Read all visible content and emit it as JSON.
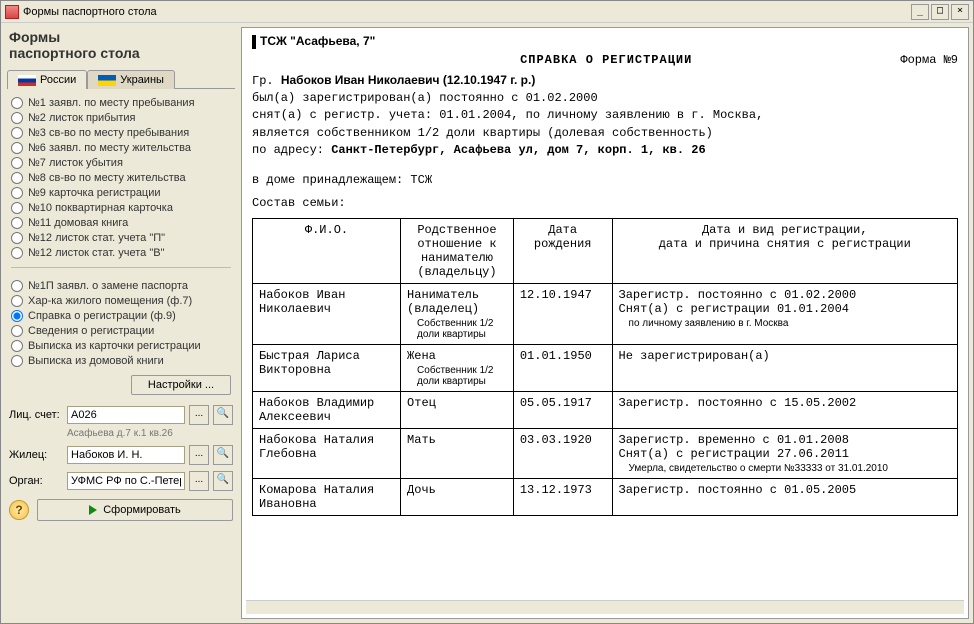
{
  "window": {
    "title": "Формы паспортного стола"
  },
  "sidebar": {
    "heading": "Формы\nпаспортного стола",
    "tabs": {
      "russia": "России",
      "ukraine": "Украины"
    },
    "group1": [
      "№1  заявл. по месту пребывания",
      "№2  листок прибытия",
      "№3  св-во по месту пребывания",
      "№6  заявл. по месту жительства",
      "№7  листок убытия",
      "№8  св-во по месту жительства",
      "№9  карточка регистрации",
      "№10 поквартирная карточка",
      "№11 домовая книга",
      "№12 листок стат. учета \"П\"",
      "№12 листок стат. учета \"В\""
    ],
    "group2": [
      "№1П  заявл. о замене паспорта",
      "Хар-ка жилого помещения (ф.7)",
      "Справка о регистрации (ф.9)",
      "Сведения о регистрации",
      "Выписка из карточки регистрации",
      "Выписка из домовой книги"
    ],
    "selected2": 2,
    "settings_btn": "Настройки ...",
    "fields": {
      "account_label": "Лиц. счет:",
      "account_value": "А026",
      "account_sub": "Асафьева д.7 к.1 кв.26",
      "tenant_label": "Жилец:",
      "tenant_value": "Набоков И. Н.",
      "org_label": "Орган:",
      "org_value": "УФМС РФ по С.-Петербургу"
    },
    "run_btn": "Сформировать"
  },
  "doc": {
    "org": "ТСЖ \"Асафьева, 7\"",
    "title": "СПРАВКА О РЕГИСТРАЦИИ",
    "form": "Форма №9",
    "person_prefix": "Гр.  ",
    "person": "Набоков Иван Николаевич (12.10.1947 г. р.)",
    "line1": "был(а) зарегистрирован(а) постоянно с 01.02.2000",
    "line2": "снят(а) с регистр. учета: 01.01.2004, по личному заявлению в г. Москва,",
    "line3": "является собственником 1/2 доли квартиры (долевая собственность)",
    "addr_label": "по адресу:  ",
    "addr_value": "Санкт-Петербург, Асафьева ул, дом 7, корп. 1, кв. 26",
    "belongs": "в доме принадлежащем:  ТСЖ",
    "family_label": "Состав семьи:",
    "columns": {
      "fio": "Ф.И.О.",
      "relation": "Родственное отношение к нанимателю (владельцу)",
      "dob": "Дата рождения",
      "reg": "Дата и вид регистрации,\nдата и причина снятия с регистрации"
    },
    "rows": [
      {
        "fio": "Набоков Иван Николаевич",
        "relation": "Наниматель (владелец)",
        "relation_sub": "Собственник 1/2 доли квартиры",
        "dob": "12.10.1947",
        "reg": "Зарегистр. постоянно с 01.02.2000\nСнят(а) с регистрации  01.01.2004",
        "reg_sub": "по личному заявлению в г. Москва"
      },
      {
        "fio": "Быстрая Лариса Викторовна",
        "relation": "Жена",
        "relation_sub": "Собственник 1/2 доли квартиры",
        "dob": "01.01.1950",
        "reg": "Не зарегистрирован(а)",
        "reg_sub": ""
      },
      {
        "fio": "Набоков Владимир Алексеевич",
        "relation": "Отец",
        "relation_sub": "",
        "dob": "05.05.1917",
        "reg": "Зарегистр. постоянно с 15.05.2002",
        "reg_sub": ""
      },
      {
        "fio": "Набокова Наталия Глебовна",
        "relation": "Мать",
        "relation_sub": "",
        "dob": "03.03.1920",
        "reg": "Зарегистр. временно с 01.01.2008\nСнят(а) с регистрации  27.06.2011",
        "reg_sub": "Умерла, свидетельство о смерти №33333 от 31.01.2010"
      },
      {
        "fio": "Комарова Наталия Ивановна",
        "relation": "Дочь",
        "relation_sub": "",
        "dob": "13.12.1973",
        "reg": "Зарегистр. постоянно с 01.05.2005",
        "reg_sub": ""
      }
    ]
  }
}
